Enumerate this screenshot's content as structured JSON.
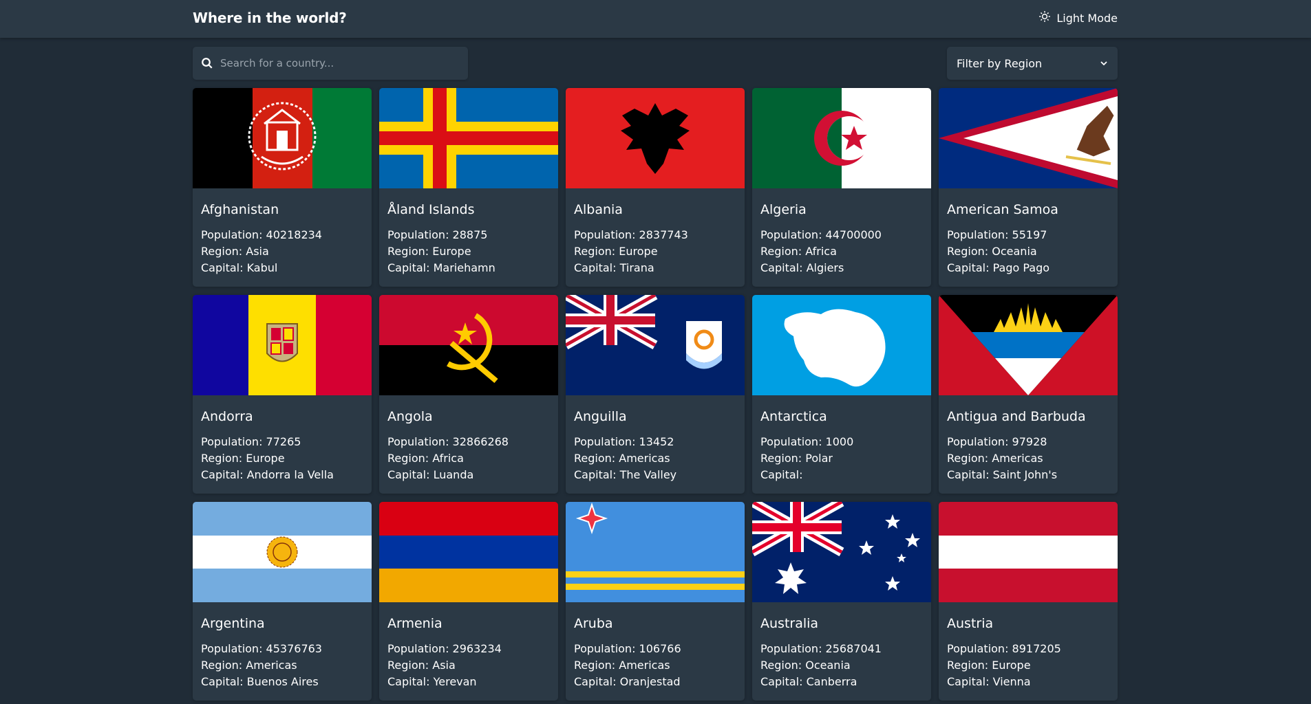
{
  "header": {
    "title": "Where in the world?",
    "theme_toggle_label": "Light Mode"
  },
  "search": {
    "placeholder": "Search for a country...",
    "value": ""
  },
  "filter": {
    "label": "Filter by Region"
  },
  "stat_labels": {
    "population": "Population:",
    "region": "Region:",
    "capital": "Capital:"
  },
  "countries": [
    {
      "name": "Afghanistan",
      "population": "40218234",
      "region": "Asia",
      "capital": "Kabul"
    },
    {
      "name": "Åland Islands",
      "population": "28875",
      "region": "Europe",
      "capital": "Mariehamn"
    },
    {
      "name": "Albania",
      "population": "2837743",
      "region": "Europe",
      "capital": "Tirana"
    },
    {
      "name": "Algeria",
      "population": "44700000",
      "region": "Africa",
      "capital": "Algiers"
    },
    {
      "name": "American Samoa",
      "population": "55197",
      "region": "Oceania",
      "capital": "Pago Pago"
    },
    {
      "name": "Andorra",
      "population": "77265",
      "region": "Europe",
      "capital": "Andorra la Vella"
    },
    {
      "name": "Angola",
      "population": "32866268",
      "region": "Africa",
      "capital": "Luanda"
    },
    {
      "name": "Anguilla",
      "population": "13452",
      "region": "Americas",
      "capital": "The Valley"
    },
    {
      "name": "Antarctica",
      "population": "1000",
      "region": "Polar",
      "capital": ""
    },
    {
      "name": "Antigua and Barbuda",
      "population": "97928",
      "region": "Americas",
      "capital": "Saint John's"
    },
    {
      "name": "Argentina",
      "population": "45376763",
      "region": "Americas",
      "capital": "Buenos Aires"
    },
    {
      "name": "Armenia",
      "population": "2963234",
      "region": "Asia",
      "capital": "Yerevan"
    },
    {
      "name": "Aruba",
      "population": "106766",
      "region": "Americas",
      "capital": "Oranjestad"
    },
    {
      "name": "Australia",
      "population": "25687041",
      "region": "Oceania",
      "capital": "Canberra"
    },
    {
      "name": "Austria",
      "population": "8917205",
      "region": "Europe",
      "capital": "Vienna"
    }
  ],
  "colors": {
    "background": "#202c37",
    "element": "#2b3945",
    "text": "#ffffff"
  }
}
